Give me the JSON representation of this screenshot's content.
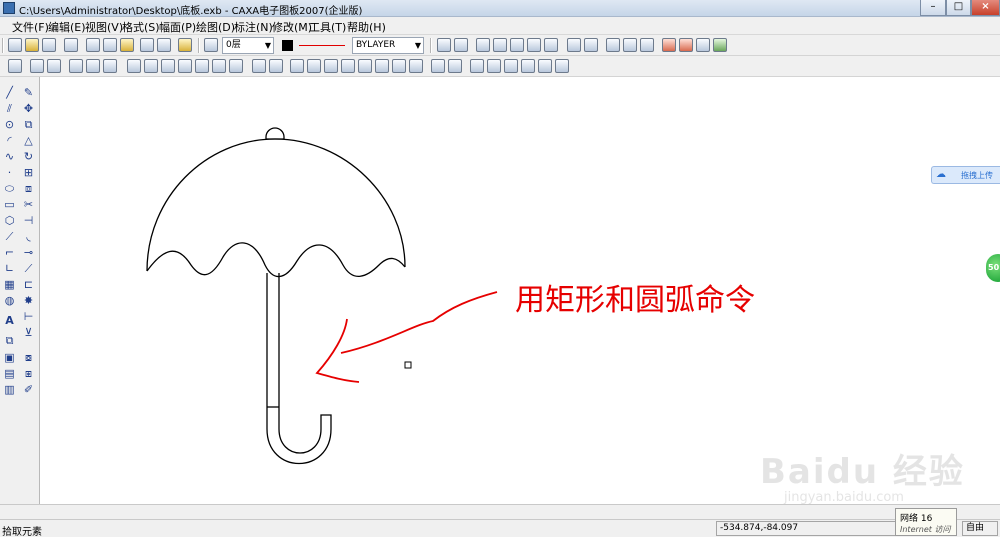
{
  "window": {
    "title": "C:\\Users\\Administrator\\Desktop\\底板.exb - CAXA电子图板2007(企业版)",
    "minimize_glyph": "–",
    "maximize_glyph": "□",
    "close_glyph": "×"
  },
  "menubar": {
    "items": [
      "文件(F)",
      "编辑(E)",
      "视图(V)",
      "格式(S)",
      "幅面(P)",
      "绘图(D)",
      "标注(N)",
      "修改(M)",
      "工具(T)",
      "帮助(H)"
    ]
  },
  "toolbar": {
    "layer_value": "0层",
    "linetype_value": "BYLAYER",
    "dropdown_glyph": "▼"
  },
  "annotation": {
    "text": "用矩形和圆弧命令",
    "color": "#e60000"
  },
  "right_float": {
    "label": "拖拽上传",
    "icon": "baidu-cloud-icon"
  },
  "green_badge": {
    "label": "50"
  },
  "statusbar": {
    "status_text": "拾取元素",
    "coordinates": "-534.874,-84.097",
    "mode": "自由"
  },
  "net_tooltip": {
    "line1": "网络  16",
    "line2": "Internet 访问"
  },
  "watermark": {
    "brand": "Baidu 经验",
    "url": "jingyan.baidu.com"
  }
}
